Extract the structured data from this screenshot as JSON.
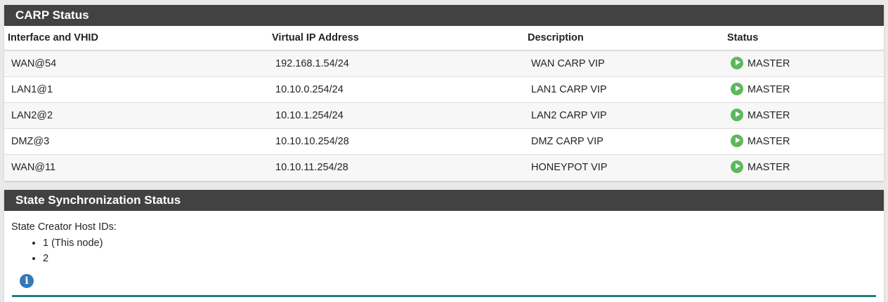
{
  "carp": {
    "title": "CARP Status",
    "columns": [
      "Interface and VHID",
      "Virtual IP Address",
      "Description",
      "Status"
    ],
    "rows": [
      {
        "iface": "WAN@54",
        "vip": "192.168.1.54/24",
        "desc": "WAN CARP VIP",
        "status": "MASTER",
        "icon": "play-circle-icon"
      },
      {
        "iface": "LAN1@1",
        "vip": "10.10.0.254/24",
        "desc": "LAN1 CARP VIP",
        "status": "MASTER",
        "icon": "play-circle-icon"
      },
      {
        "iface": "LAN2@2",
        "vip": "10.10.1.254/24",
        "desc": "LAN2 CARP VIP",
        "status": "MASTER",
        "icon": "play-circle-icon"
      },
      {
        "iface": "DMZ@3",
        "vip": "10.10.10.254/28",
        "desc": "DMZ CARP VIP",
        "status": "MASTER",
        "icon": "play-circle-icon"
      },
      {
        "iface": "WAN@11",
        "vip": "10.10.11.254/28",
        "desc": "HONEYPOT VIP",
        "status": "MASTER",
        "icon": "play-circle-icon"
      }
    ],
    "status_color": "#5cb85c"
  },
  "sync": {
    "title": "State Synchronization Status",
    "label": "State Creator Host IDs:",
    "hosts": [
      "1 (This node)",
      "2"
    ],
    "info_icon": "info-circle-icon",
    "info_color": "#337ab7"
  }
}
